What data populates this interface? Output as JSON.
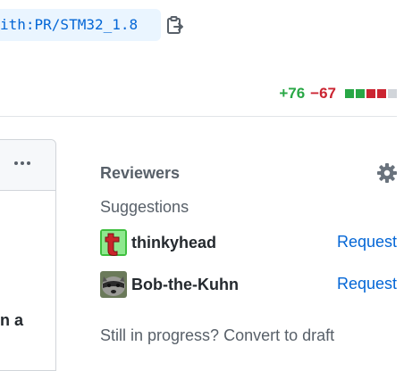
{
  "header": {
    "branch_text": "ith:PR/STM32_1.8",
    "copy_icon": "clipboard-icon"
  },
  "diffstat": {
    "additions": "+76",
    "deletions": "−67",
    "blocks": [
      "#28a745",
      "#28a745",
      "#cb2431",
      "#cb2431",
      "#d1d5da"
    ]
  },
  "comment": {
    "menu_icon": "kebab-icon",
    "text_fragment": "n a"
  },
  "sidebar": {
    "title": "Reviewers",
    "settings_icon": "gear-icon",
    "suggestions_label": "Suggestions",
    "reviewers": [
      {
        "name": "thinkyhead",
        "action": "Request"
      },
      {
        "name": "Bob-the-Kuhn",
        "action": "Request"
      }
    ],
    "draft_prefix": "Still in progress?",
    "draft_link": "Convert to draft"
  },
  "colors": {
    "link": "#0366d6",
    "add": "#28a745",
    "delete": "#cb2431",
    "muted": "#586069"
  }
}
